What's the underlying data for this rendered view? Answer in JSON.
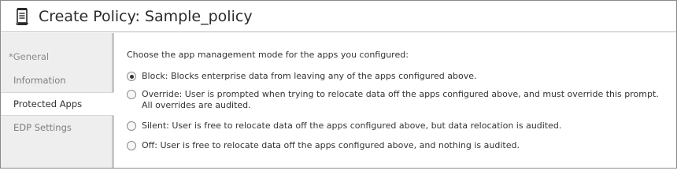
{
  "header": {
    "title": "Create Policy: Sample_policy",
    "icon": "policy-scroll-icon"
  },
  "sidebar": {
    "items": [
      {
        "label": "*General",
        "selected": false
      },
      {
        "label": "Information",
        "selected": false
      },
      {
        "label": "Protected Apps",
        "selected": true
      },
      {
        "label": "EDP Settings",
        "selected": false
      }
    ]
  },
  "main": {
    "prompt": "Choose the app management mode for the apps you configured:",
    "options": [
      {
        "label": "Block: Blocks enterprise data from leaving any of the apps configured above.",
        "checked": true
      },
      {
        "label_line1": "Override: User is prompted when trying to relocate data off the apps configured above, and must override this prompt.",
        "label_line2": "All overrides are audited.",
        "checked": false
      },
      {
        "label": "Silent: User is free to relocate data off the apps configured above, but data relocation is audited.",
        "checked": false
      },
      {
        "label": "Off: User is free to relocate data off the apps configured above, and nothing is audited.",
        "checked": false
      }
    ]
  }
}
